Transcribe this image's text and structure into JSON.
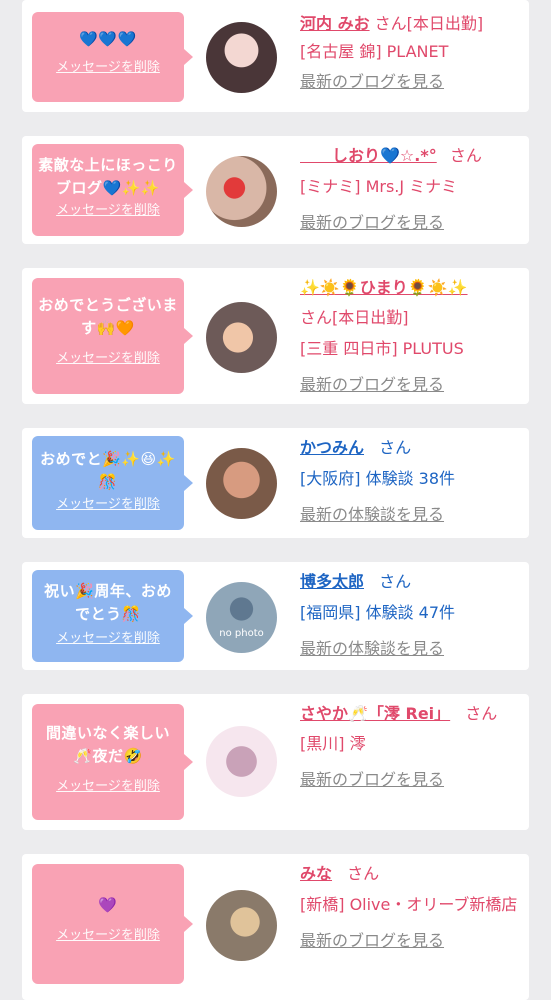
{
  "delete_label": "メッセージを削除",
  "cards": [
    {
      "message": "💙💙💙",
      "name": "河内 みお",
      "suffix": "さん[本日出勤]",
      "detail": "[名古屋 錦] PLANET",
      "link": "最新のブログを見る"
    },
    {
      "message": "素敵な上にほっこりブログ💙✨✨",
      "name": "　　しおり💙☆.*°",
      "suffix": "さん",
      "detail": "[ミナミ] Mrs.J ミナミ",
      "link": "最新のブログを見る"
    },
    {
      "message": "おめでとうございます🙌🧡",
      "name": "✨☀️🌻ひまり🌻☀️✨",
      "suffix": "さん[本日出勤]",
      "detail": "[三重 四日市] PLUTUS",
      "link": "最新のブログを見る"
    },
    {
      "message": "おめでと🎉✨😆✨🎊",
      "name": "かつみん",
      "suffix": "さん",
      "detail": "[大阪府] 体験談 38件",
      "link": "最新の体験談を見る"
    },
    {
      "message": "祝い🎉周年、おめでとう🎊",
      "name": "博多太郎",
      "suffix": "さん",
      "detail": "[福岡県] 体験談 47件",
      "link": "最新の体験談を見る",
      "avatar_text": "no photo"
    },
    {
      "message": "間違いなく楽しい🥂夜だ🤣",
      "name": "さやか🥂「澪 Rei」",
      "suffix": "さん",
      "detail": "[黒川] 澪",
      "link": "最新のブログを見る"
    },
    {
      "message": "💜",
      "name": "みな",
      "suffix": "さん",
      "detail": "[新橋] Olive・オリーブ新橋店",
      "link": "最新のブログを見る"
    }
  ]
}
